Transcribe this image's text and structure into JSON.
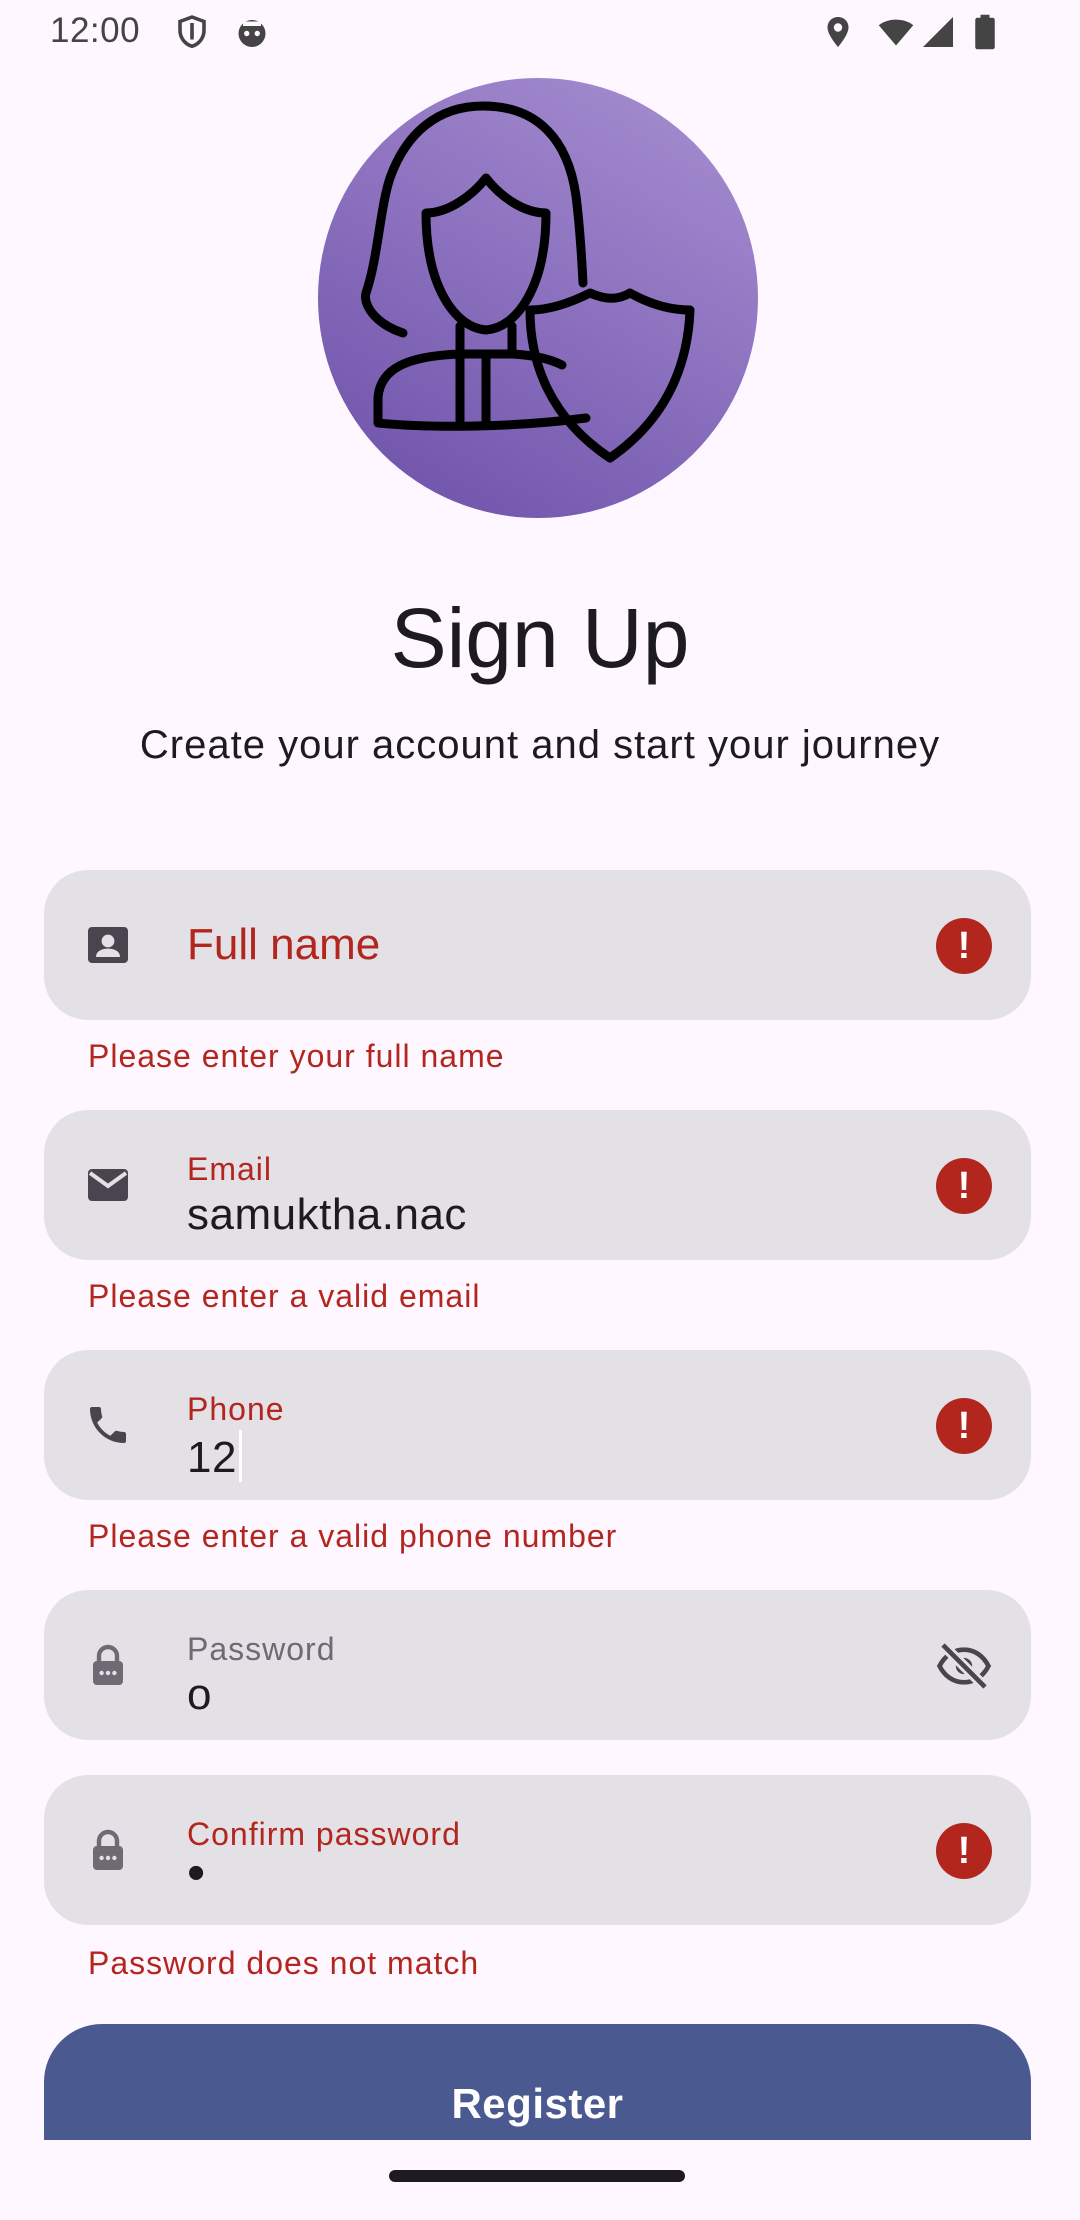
{
  "status_bar": {
    "time": "12:00",
    "left_icons": [
      "shield-icon",
      "app-icon"
    ],
    "right_icons": [
      "location-icon",
      "wifi-icon",
      "signal-icon",
      "battery-icon"
    ]
  },
  "avatar": {
    "icon": "user-shield-icon"
  },
  "header": {
    "title": "Sign Up",
    "subtitle": "Create your account and start your journey"
  },
  "form": {
    "full_name": {
      "label": "Full name",
      "value": "",
      "error": "Please enter your full name",
      "icon": "contact-card-icon"
    },
    "email": {
      "label": "Email",
      "value": "samuktha.nac",
      "error": "Please enter a valid email",
      "icon": "mail-icon"
    },
    "phone": {
      "label": "Phone",
      "value": "12",
      "error": "Please enter a valid phone number",
      "icon": "phone-icon"
    },
    "password": {
      "label": "Password",
      "value": "o",
      "icon": "lock-icon",
      "trailing_icon": "visibility-off-icon"
    },
    "confirm_password": {
      "label": "Confirm password",
      "value": "•",
      "error": "Password does not match",
      "icon": "lock-icon"
    }
  },
  "actions": {
    "register_label": "Register"
  },
  "colors": {
    "error": "#B3261E",
    "primary": "#4A5A90",
    "field_bg": "#E3E0E6",
    "background": "#FEF7FF"
  }
}
